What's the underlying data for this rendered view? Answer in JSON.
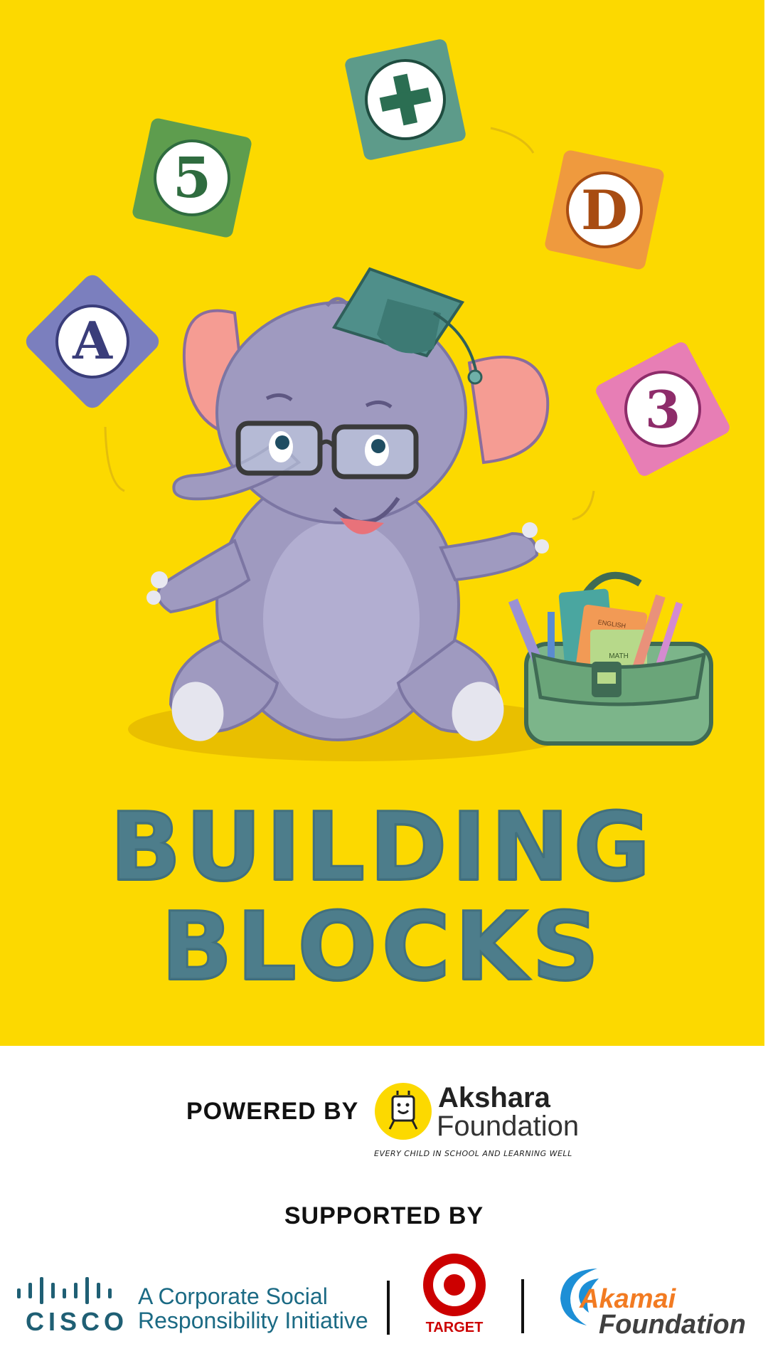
{
  "hero": {
    "title_line1": "BUILDING",
    "title_line2": "BLOCKS",
    "background_color": "#fcd900",
    "title_color": "#4d7d8b",
    "blocks": [
      {
        "label": "A",
        "color": "#7b7fbe"
      },
      {
        "label": "5",
        "color": "#5e9d4e"
      },
      {
        "label": "+",
        "color": "#5d9b8a"
      },
      {
        "label": "D",
        "color": "#ef9a3e"
      },
      {
        "label": "3",
        "color": "#e77eb5"
      }
    ],
    "mascot": "elephant-with-graduation-cap",
    "bag_books": [
      "ENGLISH",
      "MATH"
    ]
  },
  "powered_by": {
    "label": "POWERED BY",
    "org_name_line1": "Akshara",
    "org_name_line2": "Foundation",
    "tagline": "EVERY CHILD IN SCHOOL AND LEARNING WELL",
    "logo_color": "#fcd900"
  },
  "supported_by": {
    "label": "SUPPORTED BY",
    "cisco": {
      "name": "CISCO",
      "tagline_line1": "A Corporate Social",
      "tagline_line2": "Responsibility Initiative",
      "color": "#1f5f74"
    },
    "target": {
      "name": "TARGET",
      "color": "#cc0000"
    },
    "akamai": {
      "name": "Akamai",
      "sub": "Foundation",
      "color": "#f27b22"
    }
  }
}
